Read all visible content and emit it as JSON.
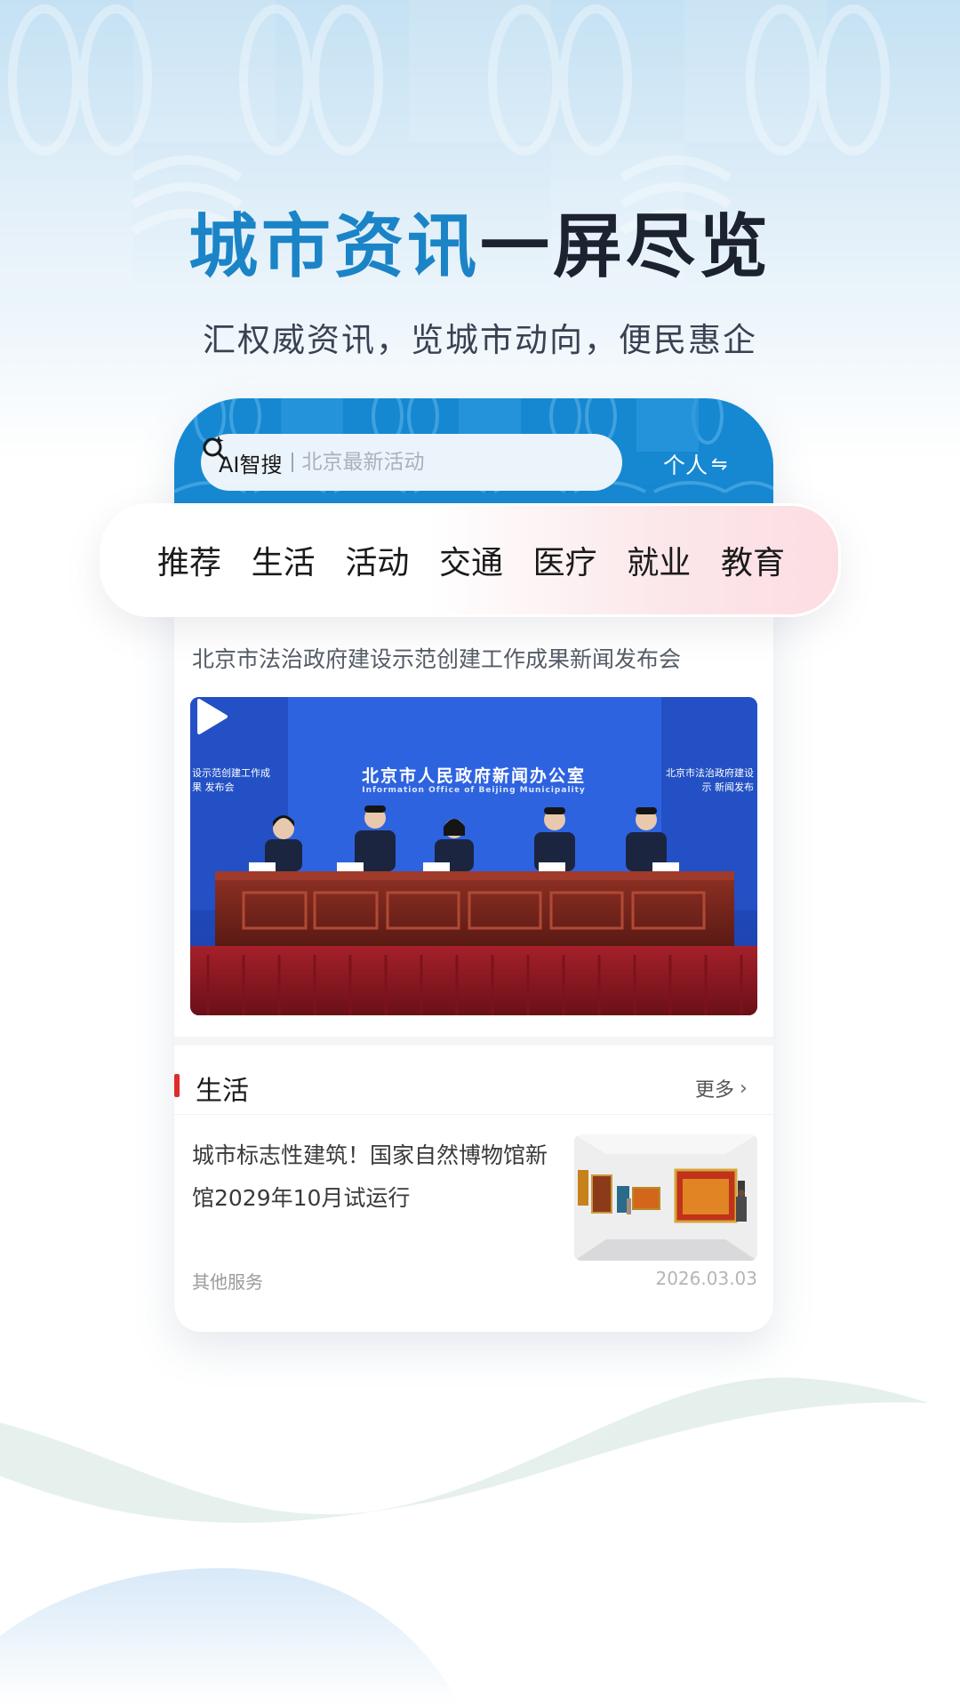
{
  "headline": {
    "part1": "城市资讯",
    "part2": "一屏尽览"
  },
  "subheadline": "汇权威资讯，览城市动向，便民惠企",
  "search": {
    "ai_label": "AI智搜",
    "placeholder": "北京最新活动"
  },
  "personal_label": "个人",
  "tabs": [
    "推荐",
    "生活",
    "活动",
    "交通",
    "医疗",
    "就业",
    "教育"
  ],
  "featured": {
    "title": "北京市法治政府建设示范创建工作成果新闻发布会",
    "board_title": "北京市人民政府新闻办公室",
    "board_subtitle": "Information Office of Beijing Municipality",
    "side_left": "设示范创建工作成果 发布会",
    "side_right": "北京市法治政府建设示 新闻发布"
  },
  "section": {
    "title": "生活",
    "more_label": "更多"
  },
  "article": {
    "title": "城市标志性建筑！国家自然博物馆新馆2029年10月试运行",
    "source": "其他服务",
    "date": "2026.03.03"
  },
  "colors": {
    "brand_blue": "#1b84c7",
    "accent_red": "#e02b2b",
    "headline_dark": "#1c2230"
  }
}
